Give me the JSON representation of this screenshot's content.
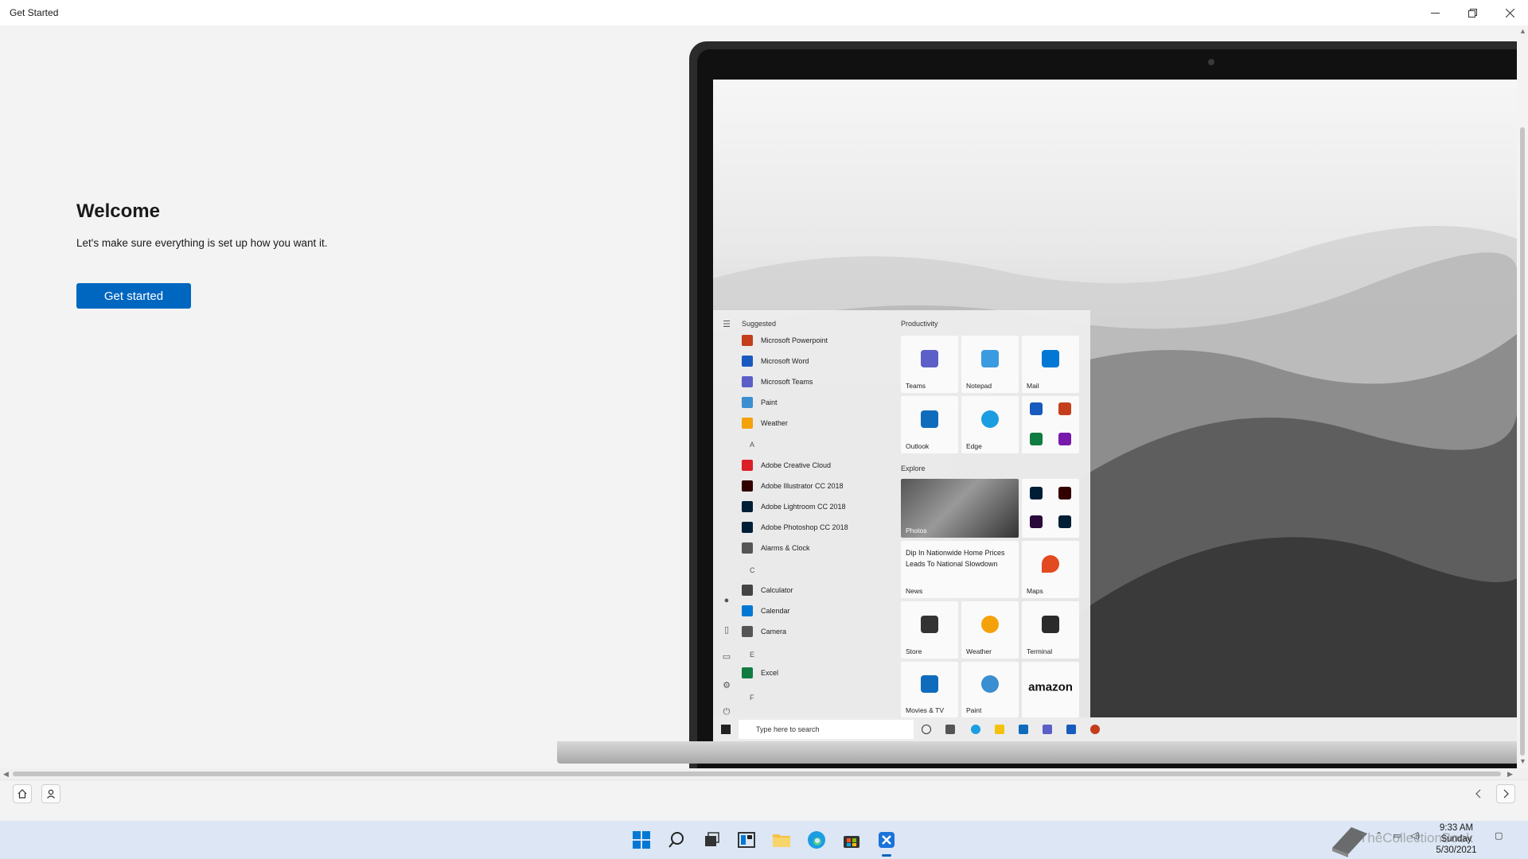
{
  "window": {
    "title": "Get Started"
  },
  "welcome": {
    "title": "Welcome",
    "subtitle": "Let's make sure everything is set up how you want it.",
    "button_label": "Get started"
  },
  "illustration": {
    "start_menu": {
      "suggested_heading": "Suggested",
      "productivity_heading": "Productivity",
      "explore_heading": "Explore",
      "apps": [
        {
          "label": "Microsoft Powerpoint",
          "color": "#c43e1c"
        },
        {
          "label": "Microsoft Word",
          "color": "#185abd"
        },
        {
          "label": "Microsoft Teams",
          "color": "#5b5fc7"
        },
        {
          "label": "Paint",
          "color": "#3b8ed0"
        },
        {
          "label": "Weather",
          "color": "#f4a20c"
        },
        {
          "label": "Adobe Creative Cloud",
          "color": "#da1f26"
        },
        {
          "label": "Adobe Illustrator CC 2018",
          "color": "#330000"
        },
        {
          "label": "Adobe Lightroom CC 2018",
          "color": "#001e36"
        },
        {
          "label": "Adobe Photoshop CC 2018",
          "color": "#001e36"
        },
        {
          "label": "Alarms & Clock",
          "color": "#555555"
        },
        {
          "label": "Calculator",
          "color": "#444444"
        },
        {
          "label": "Calendar",
          "color": "#0078d4"
        },
        {
          "label": "Camera",
          "color": "#555555"
        },
        {
          "label": "Excel",
          "color": "#107c41"
        }
      ],
      "letters": [
        "A",
        "C",
        "E",
        "F"
      ],
      "tiles": {
        "teams": "Teams",
        "notepad": "Notepad",
        "mail": "Mail",
        "outlook": "Outlook",
        "edge": "Edge",
        "photos": "Photos",
        "news_headline": "Dip In Nationwide Home Prices Leads To National Slowdown",
        "news": "News",
        "maps": "Maps",
        "store": "Store",
        "weather": "Weather",
        "terminal": "Terminal",
        "movies": "Movies & TV",
        "paint": "Paint",
        "amazon": "amazon"
      },
      "search_placeholder": "Type here to search"
    }
  },
  "taskbar": {
    "time": "9:33 AM",
    "day": "Sunday",
    "date": "5/30/2021",
    "watermark": "TheCollectionBook",
    "active_color": "#0067c0"
  }
}
